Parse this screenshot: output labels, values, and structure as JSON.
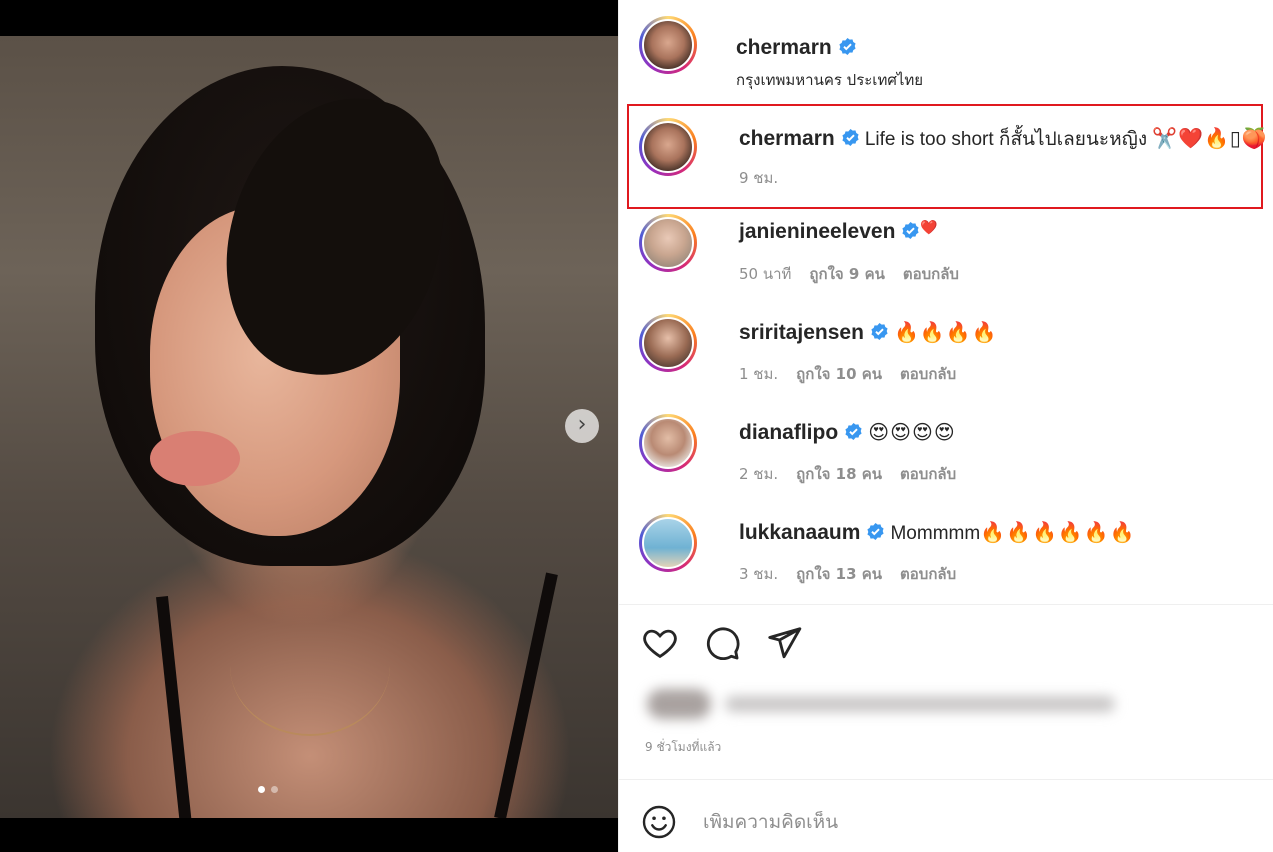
{
  "post": {
    "username": "chermarn",
    "location": "กรุงเทพมหานคร ประเทศไทย",
    "carousel": {
      "total": 2,
      "current": 1
    }
  },
  "caption": {
    "username": "chermarn",
    "text": "Life is too short ก็สั้นไปเลยนะหญิง",
    "emoji": "✂️❤️🔥▯🍑",
    "time": "9 ชม."
  },
  "comments": [
    {
      "username": "janienineeleven",
      "text": "",
      "emoji": "❤️",
      "time": "50 นาที",
      "likes": "ถูกใจ 9 คน",
      "reply": "ตอบกลับ"
    },
    {
      "username": "sriritajensen",
      "text": "",
      "emoji": "🔥🔥🔥🔥",
      "time": "1 ชม.",
      "likes": "ถูกใจ 10 คน",
      "reply": "ตอบกลับ"
    },
    {
      "username": "dianaflipo",
      "text": "",
      "emoji": "😍😍😍😍",
      "time": "2 ชม.",
      "likes": "ถูกใจ 18 คน",
      "reply": "ตอบกลับ"
    },
    {
      "username": "lukkanaaum",
      "text": "Mommmm",
      "emoji": "🔥🔥🔥🔥🔥🔥",
      "time": "3 ชม.",
      "likes": "ถูกใจ 13 คน",
      "reply": "ตอบกลับ"
    }
  ],
  "footer": {
    "time_ago": "9 ชั่วโมงที่แล้ว",
    "comment_placeholder": "เพิ่มความคิดเห็น"
  },
  "icons": {
    "verified": "verified-badge-icon",
    "like": "heart-icon",
    "comment": "comment-bubble-icon",
    "share": "paper-plane-icon",
    "next": "chevron-right-icon",
    "emoji": "smiley-icon"
  },
  "colors": {
    "verified_blue": "#3897f0",
    "highlight_border": "#e0191f",
    "muted_text": "#8e8e8e"
  }
}
